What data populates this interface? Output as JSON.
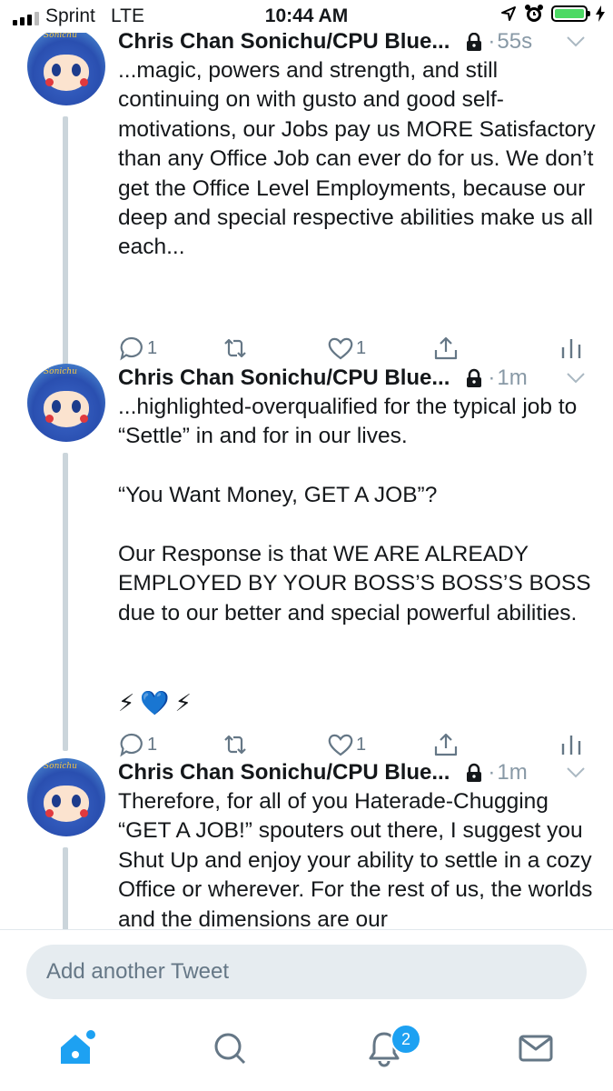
{
  "status_bar": {
    "carrier": "Sprint",
    "network": "LTE",
    "time": "10:44 AM"
  },
  "tweets": [
    {
      "author": "Chris Chan Sonichu/CPU Blue...",
      "time": "55s",
      "avatar_tag": "Sonichu",
      "text": "...magic, powers and strength, and still continuing on with gusto and good self-motivations, our Jobs pay us MORE Satisfactory than any Office Job can ever do for us. We don’t get the Office Level Employments, because our deep and special respective abilities make us all each...",
      "reply_count": "1",
      "like_count": "1"
    },
    {
      "author": "Chris Chan Sonichu/CPU Blue...",
      "time": "1m",
      "avatar_tag": "Sonichu",
      "text": "...highlighted-overqualified for the typical job to “Settle” in and for in our lives.\n\n“You Want Money, GET A JOB”?\n\nOur Response is that WE ARE ALREADY EMPLOYED BY YOUR BOSS’S BOSS’S BOSS due to our better and special powerful abilities.",
      "emoji": "⚡💙⚡",
      "reply_count": "1",
      "like_count": "1"
    },
    {
      "author": "Chris Chan Sonichu/CPU Blue...",
      "time": "1m",
      "avatar_tag": "Sonichu",
      "text": "Therefore, for all of you Haterade-Chugging “GET A JOB!” spouters out there, I suggest you Shut Up and enjoy your ability to settle in a cozy Office or wherever. For the rest of us, the worlds and the dimensions are our"
    }
  ],
  "compose": {
    "placeholder": "Add another Tweet"
  },
  "tab_bar": {
    "notifications_badge": "2"
  },
  "colors": {
    "accent": "#1da1f2",
    "icon_gray": "#657786",
    "thread_line": "#cbd5db",
    "battery": "#4cd964"
  }
}
